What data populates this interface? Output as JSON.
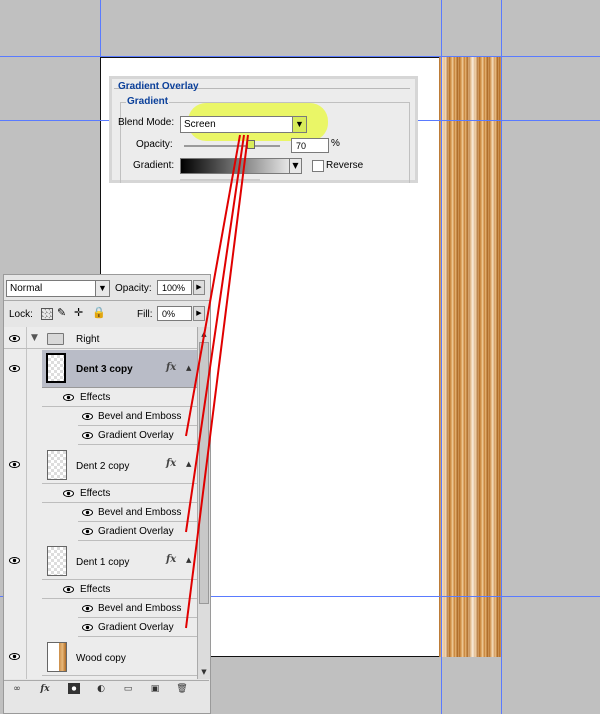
{
  "colors": {
    "canvas_bg": "#c0c0c0",
    "guide": "#5a7bff",
    "dialog_heading": "#0a3f9a",
    "highlight": "#eaf760",
    "annotation_line": "#e00000",
    "selected_row": "#b9bcc7"
  },
  "dialog": {
    "title": "Gradient Overlay",
    "group": "Gradient",
    "blend_mode_label": "Blend Mode:",
    "blend_mode_value": "Screen",
    "opacity_label": "Opacity:",
    "opacity_value": "70",
    "opacity_unit": "%",
    "opacity_level": 0.7,
    "gradient_label": "Gradient:",
    "reverse_label": "Reverse",
    "reverse_checked": false
  },
  "layers_panel": {
    "blend_mode": "Normal",
    "opacity_label": "Opacity:",
    "opacity_value": "100%",
    "lock_label": "Lock:",
    "fill_label": "Fill:",
    "fill_value": "0%",
    "group_name": "Right",
    "effects_label": "Effects",
    "effect_bevel": "Bevel and Emboss",
    "effect_gradient": "Gradient Overlay",
    "layers": [
      {
        "name": "Dent 3 copy",
        "selected": true
      },
      {
        "name": "Dent 2 copy",
        "selected": false
      },
      {
        "name": "Dent 1 copy",
        "selected": false
      }
    ],
    "bottom_layer": "Wood copy",
    "footer_icons": [
      "link-icon",
      "fx-icon",
      "mask-icon",
      "adjustment-icon",
      "folder-icon",
      "new-layer-icon",
      "trash-icon"
    ]
  }
}
